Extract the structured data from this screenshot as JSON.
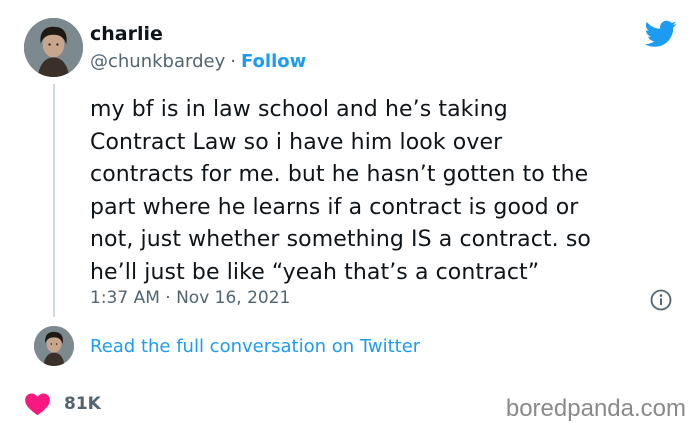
{
  "author": {
    "display_name": "charlie",
    "handle": "@chunkbardey",
    "separator": "·",
    "follow_label": "Follow"
  },
  "tweet": {
    "text": "my bf is in law school and he’s taking\nContract Law so i have him look over\ncontracts for me. but he hasn’t gotten to the\npart where he learns if a contract is good or\nnot, just whether something IS a contract. so\nhe’ll just be like “yeah that’s a contract”",
    "timestamp": "1:37 AM · Nov 16, 2021"
  },
  "conversation": {
    "link_label": "Read the full conversation on Twitter"
  },
  "engagement": {
    "likes": "81K"
  },
  "watermark": "boredpanda.com",
  "icons": {
    "brand": "twitter-bird-icon",
    "info": "info-icon",
    "like": "heart-icon"
  },
  "colors": {
    "accent": "#1d9bf0",
    "heart": "#f91880",
    "text": "#0f1419",
    "muted": "#536471",
    "thread_line": "#cfd9de"
  }
}
